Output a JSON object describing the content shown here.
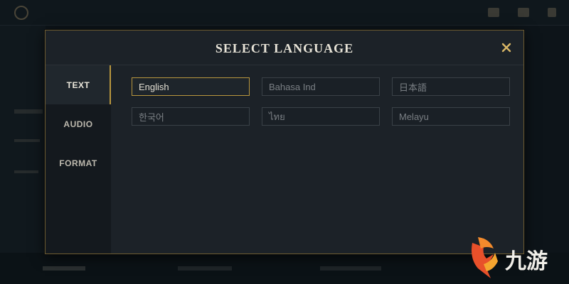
{
  "colors": {
    "accent": "#b8963e",
    "panel": "#1c2228",
    "text": "#e8e4d8"
  },
  "dialog": {
    "title": "SELECT LANGUAGE",
    "close_icon": "close-icon"
  },
  "tabs": [
    {
      "label": "TEXT",
      "active": true
    },
    {
      "label": "AUDIO",
      "active": false
    },
    {
      "label": "FORMAT",
      "active": false
    }
  ],
  "languages": [
    {
      "label": "English",
      "selected": true
    },
    {
      "label": "Bahasa Ind",
      "selected": false
    },
    {
      "label": "日本語",
      "selected": false
    },
    {
      "label": "한국어",
      "selected": false
    },
    {
      "label": "ไทย",
      "selected": false
    },
    {
      "label": "Melayu",
      "selected": false
    }
  ],
  "watermark": {
    "text": "九游"
  }
}
